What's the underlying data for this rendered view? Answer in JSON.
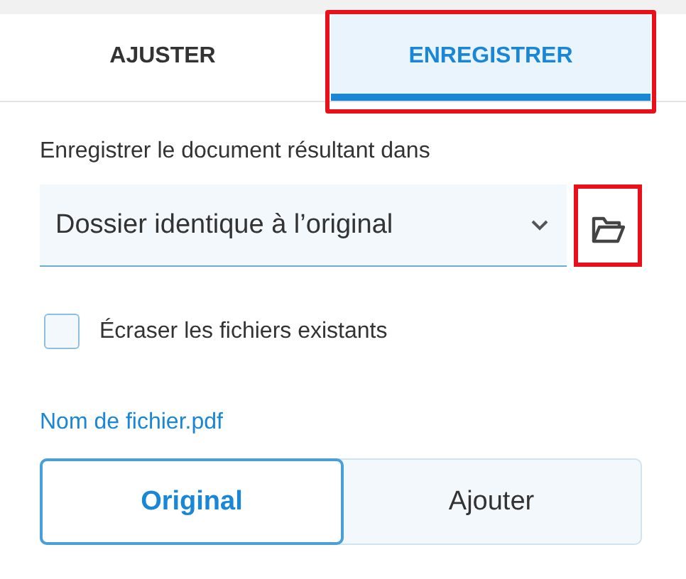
{
  "tabs": [
    {
      "label": "AJUSTER",
      "selected": false,
      "highlighted": false
    },
    {
      "label": "ENREGISTRER",
      "selected": true,
      "highlighted": true
    }
  ],
  "save_location": {
    "label": "Enregistrer le document résultant dans",
    "value": "Dossier identique à l’original",
    "browse_highlighted": true
  },
  "overwrite": {
    "label": "Écraser les fichiers existants",
    "checked": false
  },
  "file_name": "Nom de fichier.pdf",
  "name_mode": [
    {
      "label": "Original",
      "selected": true
    },
    {
      "label": "Ajouter",
      "selected": false
    }
  ]
}
